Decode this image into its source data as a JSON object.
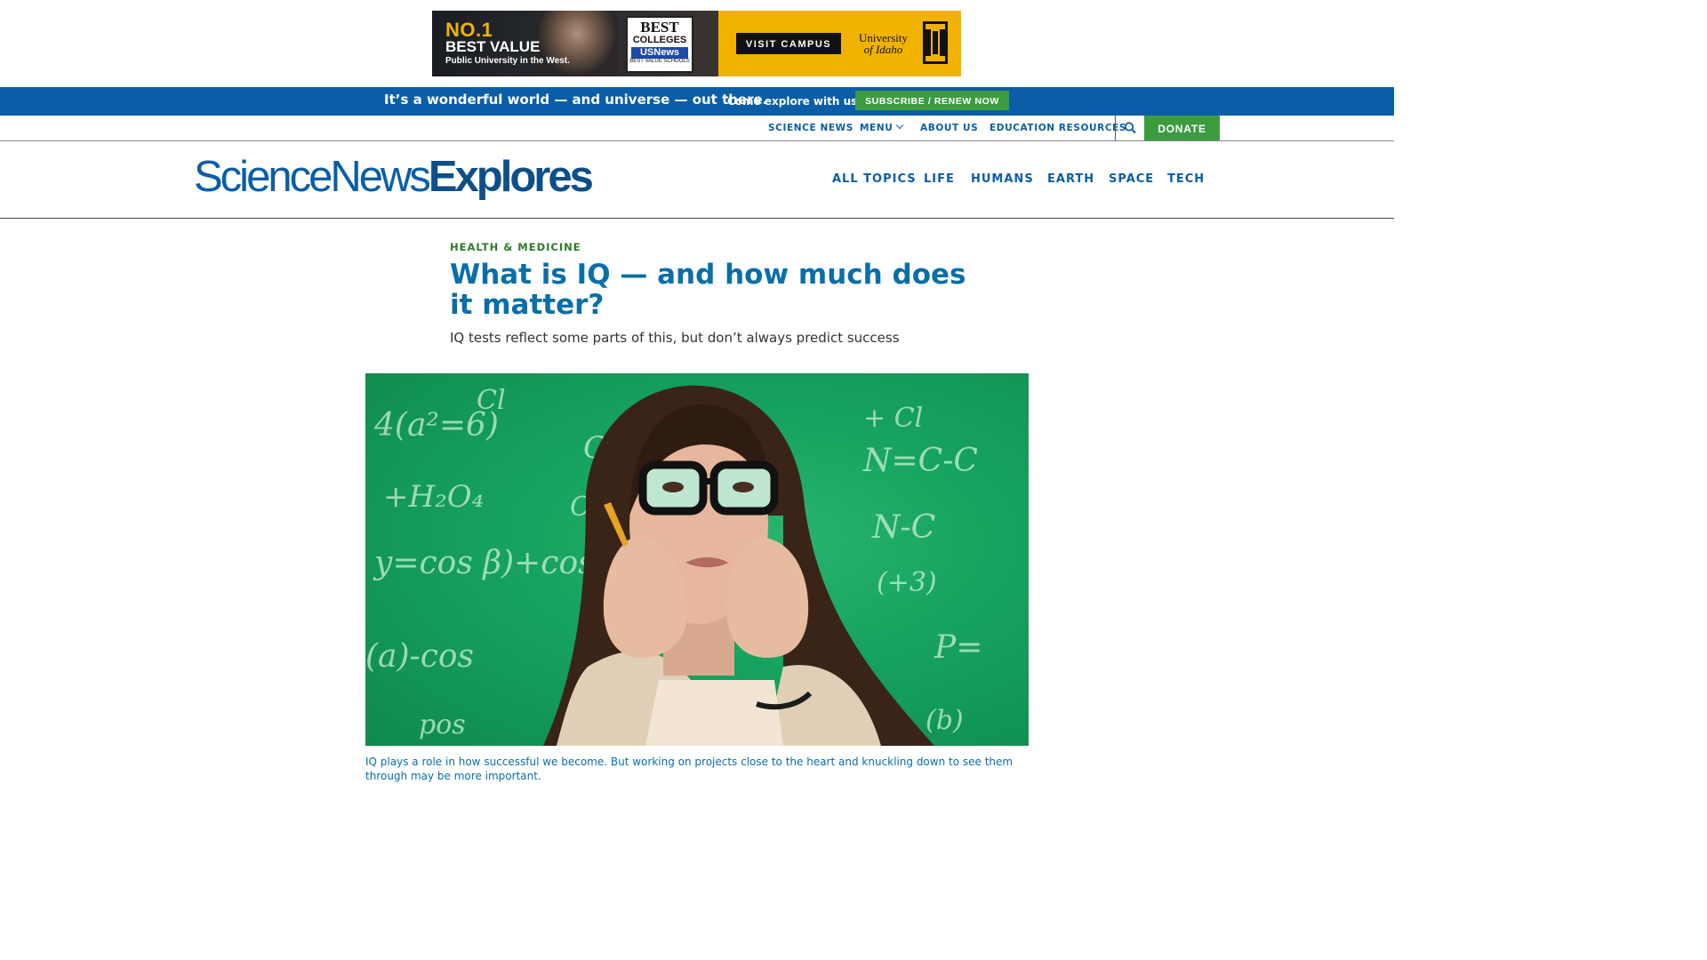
{
  "ad": {
    "headline_1": "NO.1",
    "headline_2": "BEST VALUE",
    "subline": "Public University in the West.",
    "badge_line_1": "BEST",
    "badge_line_2": "COLLEGES",
    "badge_line_3": "USNews",
    "badge_line_4": "BEST VALUE SCHOOLS",
    "cta_label": "VISIT CAMPUS",
    "university_line_1": "University",
    "university_line_2": "of Idaho"
  },
  "promo": {
    "main_text": "It’s a wonderful world — and universe — out there.",
    "sub_text": "Come explore with us!",
    "button_label": "SUBSCRIBE / RENEW NOW"
  },
  "utility_nav": {
    "items": [
      "SCIENCE NEWS",
      "MENU",
      "ABOUT US",
      "EDUCATION RESOURCES"
    ],
    "donate_label": "DONATE",
    "search_icon": "search-icon"
  },
  "masthead": {
    "logo_part_1": "ScienceNews",
    "logo_part_2": "Explores",
    "topics": [
      "ALL TOPICS",
      "LIFE",
      "HUMANS",
      "EARTH",
      "SPACE",
      "TECH"
    ]
  },
  "article": {
    "kicker": "HEALTH & MEDICINE",
    "headline": "What is IQ — and how much does it matter?",
    "dek": "IQ tests reflect some parts of this, but don’t always predict success",
    "caption": "IQ plays a role in how successful we become. But working on projects close to the heart and knuckling down to see them through may be more important.",
    "hero_formulas": [
      "4(a²=6)",
      "CH₂-",
      "Cl",
      "N=C-C",
      "+H₂O₄",
      "+ Cl",
      "N-C",
      "CY",
      "y=cos β)+cos",
      "(+3)",
      "(a)-cos",
      "P=",
      "pos",
      "(b)"
    ]
  },
  "colors": {
    "brand_blue": "#0a5ea8",
    "headline_blue": "#0a6ea8",
    "kicker_green": "#2f7a2c",
    "button_green": "#3d9b40",
    "ad_gold": "#f1b300"
  }
}
